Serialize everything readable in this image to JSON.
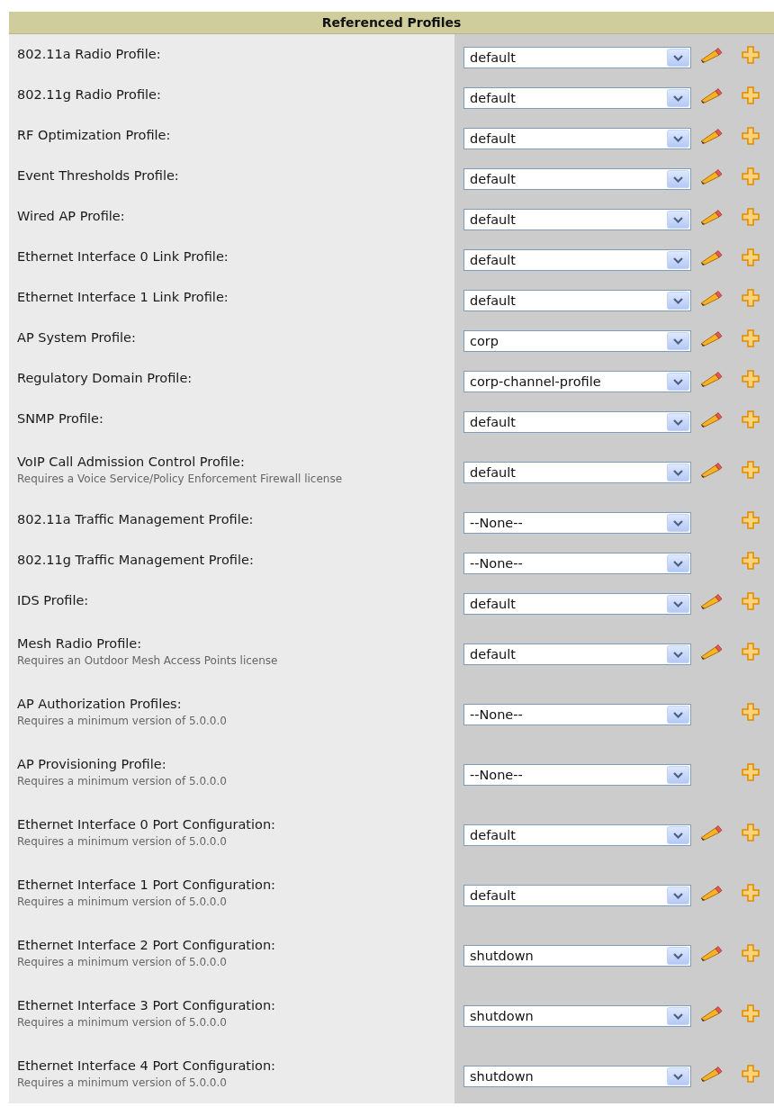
{
  "title": "Referenced Profiles",
  "rows": [
    {
      "label": "802.11a Radio Profile:",
      "value": "default",
      "editable": true
    },
    {
      "label": "802.11g Radio Profile:",
      "value": "default",
      "editable": true
    },
    {
      "label": "RF Optimization Profile:",
      "value": "default",
      "editable": true
    },
    {
      "label": "Event Thresholds Profile:",
      "value": "default",
      "editable": true
    },
    {
      "label": "Wired AP Profile:",
      "value": "default",
      "editable": true
    },
    {
      "label": "Ethernet Interface 0 Link Profile:",
      "value": "default",
      "editable": true
    },
    {
      "label": "Ethernet Interface 1 Link Profile:",
      "value": "default",
      "editable": true
    },
    {
      "label": "AP System Profile:",
      "value": "corp",
      "editable": true
    },
    {
      "label": "Regulatory Domain Profile:",
      "value": "corp-channel-profile",
      "editable": true
    },
    {
      "label": "SNMP Profile:",
      "value": "default",
      "editable": true
    },
    {
      "label": "VoIP Call Admission Control Profile:",
      "note": "Requires a Voice Service/Policy Enforcement Firewall license",
      "value": "default",
      "editable": true
    },
    {
      "label": "802.11a Traffic Management Profile:",
      "value": "--None--",
      "editable": false
    },
    {
      "label": "802.11g Traffic Management Profile:",
      "value": "--None--",
      "editable": false
    },
    {
      "label": "IDS Profile:",
      "value": "default",
      "editable": true
    },
    {
      "label": "Mesh Radio Profile:",
      "note": "Requires an Outdoor Mesh Access Points license",
      "value": "default",
      "editable": true
    },
    {
      "label": "AP Authorization Profiles:",
      "note": "Requires a minimum version of 5.0.0.0",
      "value": "--None--",
      "editable": false
    },
    {
      "label": "AP Provisioning Profile:",
      "note": "Requires a minimum version of 5.0.0.0",
      "value": "--None--",
      "editable": false
    },
    {
      "label": "Ethernet Interface 0 Port Configuration:",
      "note": "Requires a minimum version of 5.0.0.0",
      "value": "default",
      "editable": true
    },
    {
      "label": "Ethernet Interface 1 Port Configuration:",
      "note": "Requires a minimum version of 5.0.0.0",
      "value": "default",
      "editable": true
    },
    {
      "label": "Ethernet Interface 2 Port Configuration:",
      "note": "Requires a minimum version of 5.0.0.0",
      "value": "shutdown",
      "editable": true
    },
    {
      "label": "Ethernet Interface 3 Port Configuration:",
      "note": "Requires a minimum version of 5.0.0.0",
      "value": "shutdown",
      "editable": true
    },
    {
      "label": "Ethernet Interface 4 Port Configuration:",
      "note": "Requires a minimum version of 5.0.0.0",
      "value": "shutdown",
      "editable": true
    }
  ]
}
